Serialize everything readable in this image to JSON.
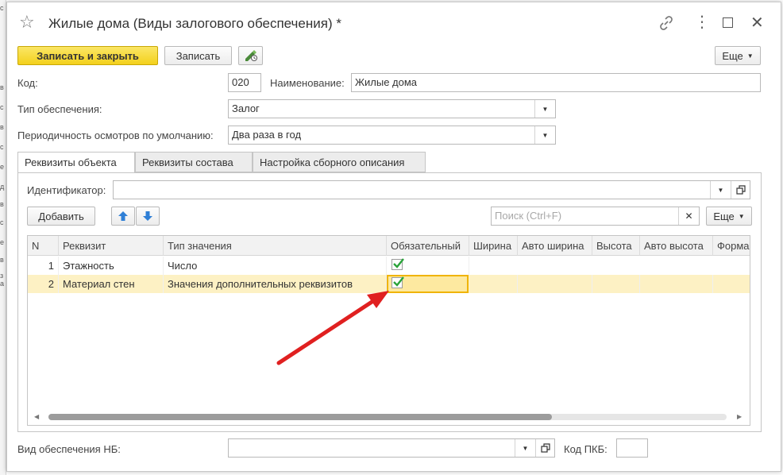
{
  "window": {
    "title": "Жилые дома (Виды залогового обеспечения) *"
  },
  "toolbar": {
    "save_close_label": "Записать и закрыть",
    "save_label": "Записать",
    "more_label": "Еще"
  },
  "form": {
    "code_label": "Код:",
    "code_value": "020",
    "name_label": "Наименование:",
    "name_value": "Жилые дома",
    "type_label": "Тип обеспечения:",
    "type_value": "Залог",
    "period_label": "Периодичность осмотров по умолчанию:",
    "period_value": "Два раза в год"
  },
  "tabs": [
    {
      "label": "Реквизиты объекта",
      "active": true
    },
    {
      "label": "Реквизиты состава",
      "active": false
    },
    {
      "label": "Настройка сборного описания",
      "active": false
    }
  ],
  "panel": {
    "identifier_label": "Идентификатор:",
    "identifier_value": "",
    "add_label": "Добавить",
    "search_placeholder": "Поиск (Ctrl+F)",
    "more_label": "Еще"
  },
  "table": {
    "columns": [
      "N",
      "Реквизит",
      "Тип значения",
      "Обязательный",
      "Ширина",
      "Авто ширина",
      "Высота",
      "Авто высота",
      "Форма"
    ],
    "rows": [
      {
        "n": "1",
        "attr": "Этажность",
        "type": "Число",
        "required": true,
        "selected": false
      },
      {
        "n": "2",
        "attr": "Материал стен",
        "type": "Значения дополнительных реквизитов",
        "required": true,
        "selected": true
      }
    ]
  },
  "footer": {
    "nb_label": "Вид обеспечения НБ:",
    "nb_value": "",
    "pkb_label": "Код ПКБ:",
    "pkb_value": ""
  },
  "left_strip_letters": [
    "с",
    "в",
    "с",
    "в",
    "с",
    "е",
    "д",
    "в",
    "с",
    "е",
    "в",
    "з",
    "а"
  ],
  "colors": {
    "primary_button": "#f3d01c",
    "selected_row": "#fdf1c4",
    "check": "#2aa33a",
    "annotation_arrow": "#e02020"
  }
}
